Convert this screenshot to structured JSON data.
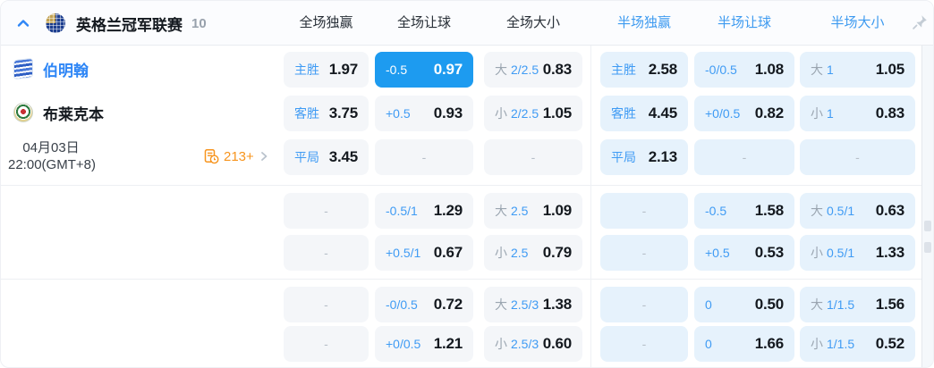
{
  "header": {
    "league": "英格兰冠军联赛",
    "count": "10",
    "columns": [
      {
        "label": "全场独赢",
        "half": false
      },
      {
        "label": "全场让球",
        "half": false
      },
      {
        "label": "全场大小",
        "half": false
      },
      {
        "label": "半场独赢",
        "half": true
      },
      {
        "label": "半场让球",
        "half": true
      },
      {
        "label": "半场大小",
        "half": true
      }
    ],
    "icons": {
      "collapse": "chevron-up",
      "pin": "pushpin"
    }
  },
  "match": {
    "home_team": "伯明翰",
    "away_team": "布莱克本",
    "date": "04月03日",
    "time": "22:00(GMT+8)",
    "more_markets": "213+",
    "icons": {
      "more": "doc-clock + chevron-right"
    }
  },
  "colors": {
    "accent_blue": "#2e86f6",
    "label_blue": "#3f9bf4",
    "highlight_cell_bg": "#1d9bf0",
    "full_cell_bg": "#f4f6f9",
    "half_cell_bg": "#e6f2fc",
    "orange": "#f7941d",
    "value_text": "#14191f",
    "ou_prefix_gray": "#9aa5b0"
  },
  "sections": [
    {
      "rows": [
        {
          "cells": [
            {
              "label": "主胜",
              "value": "1.97"
            },
            {
              "label": "-0.5",
              "value": "0.97",
              "highlight": true
            },
            {
              "prefix": "大",
              "label": "2/2.5",
              "value": "0.83"
            },
            {
              "label": "主胜",
              "value": "2.58"
            },
            {
              "label": "-0/0.5",
              "value": "1.08"
            },
            {
              "prefix": "大",
              "label": "1",
              "value": "1.05"
            }
          ]
        },
        {
          "cells": [
            {
              "label": "客胜",
              "value": "3.75"
            },
            {
              "label": "+0.5",
              "value": "0.93"
            },
            {
              "prefix": "小",
              "label": "2/2.5",
              "value": "1.05"
            },
            {
              "label": "客胜",
              "value": "4.45"
            },
            {
              "label": "+0/0.5",
              "value": "0.82"
            },
            {
              "prefix": "小",
              "label": "1",
              "value": "0.83"
            }
          ]
        },
        {
          "cells": [
            {
              "label": "平局",
              "value": "3.45"
            },
            {
              "dash": true
            },
            {
              "dash": true
            },
            {
              "label": "平局",
              "value": "2.13"
            },
            {
              "dash": true
            },
            {
              "dash": true
            }
          ]
        }
      ]
    },
    {
      "rows": [
        {
          "cells": [
            {
              "dash": true
            },
            {
              "label": "-0.5/1",
              "value": "1.29"
            },
            {
              "prefix": "大",
              "label": "2.5",
              "value": "1.09"
            },
            {
              "dash": true
            },
            {
              "label": "-0.5",
              "value": "1.58"
            },
            {
              "prefix": "大",
              "label": "0.5/1",
              "value": "0.63"
            }
          ]
        },
        {
          "cells": [
            {
              "dash": true
            },
            {
              "label": "+0.5/1",
              "value": "0.67"
            },
            {
              "prefix": "小",
              "label": "2.5",
              "value": "0.79"
            },
            {
              "dash": true
            },
            {
              "label": "+0.5",
              "value": "0.53"
            },
            {
              "prefix": "小",
              "label": "0.5/1",
              "value": "1.33"
            }
          ]
        }
      ]
    },
    {
      "rows": [
        {
          "cells": [
            {
              "dash": true
            },
            {
              "label": "-0/0.5",
              "value": "0.72"
            },
            {
              "prefix": "大",
              "label": "2.5/3",
              "value": "1.38"
            },
            {
              "dash": true
            },
            {
              "label": "0",
              "value": "0.50"
            },
            {
              "prefix": "大",
              "label": "1/1.5",
              "value": "1.56"
            }
          ]
        },
        {
          "cells": [
            {
              "dash": true
            },
            {
              "label": "+0/0.5",
              "value": "1.21"
            },
            {
              "prefix": "小",
              "label": "2.5/3",
              "value": "0.60"
            },
            {
              "dash": true
            },
            {
              "label": "0",
              "value": "1.66"
            },
            {
              "prefix": "小",
              "label": "1/1.5",
              "value": "0.52"
            }
          ]
        }
      ]
    }
  ]
}
